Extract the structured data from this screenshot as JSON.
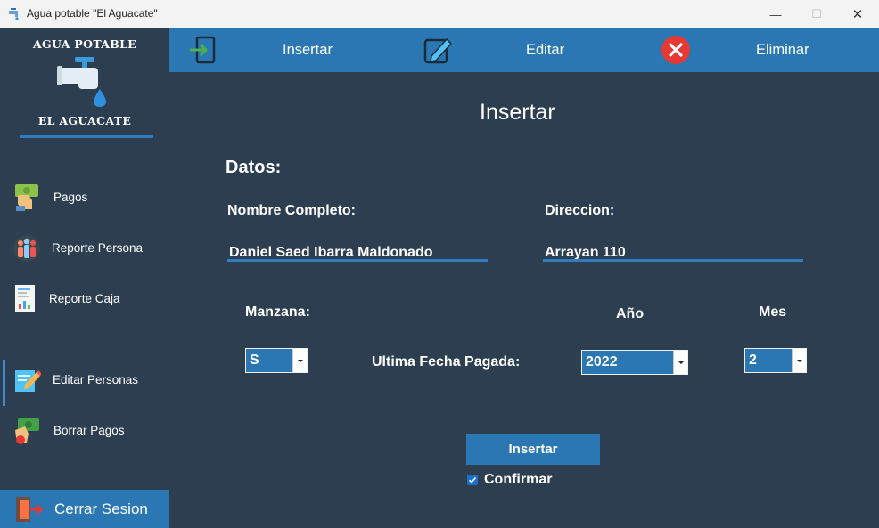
{
  "window": {
    "title": "Agua potable \"El Aguacate\"",
    "controls": {
      "minimize": "—",
      "maximize": "☐",
      "close": "✕"
    }
  },
  "sidebar": {
    "brand_top": "AGUA POTABLE",
    "brand_bottom": "EL AGUACATE",
    "items": [
      {
        "label": "Pagos",
        "icon": "cash-hand-icon"
      },
      {
        "label": "Reporte Persona",
        "icon": "people-group-icon"
      },
      {
        "label": "Reporte Caja",
        "icon": "report-document-icon"
      },
      {
        "label": "Editar Personas",
        "icon": "edit-note-icon",
        "active": true
      },
      {
        "label": "Borrar Pagos",
        "icon": "money-delete-icon"
      }
    ],
    "logout_label": "Cerrar Sesion"
  },
  "toolbar": {
    "insert_label": "Insertar",
    "edit_label": "Editar",
    "delete_label": "Eliminar"
  },
  "form": {
    "heading": "Insertar",
    "section_label": "Datos:",
    "name_label": "Nombre Completo:",
    "name_value": "Daniel Saed Ibarra Maldonado",
    "address_label": "Direccion:",
    "address_value": "Arrayan 110",
    "manzana_label": "Manzana:",
    "manzana_value": "S",
    "year_label": "Año",
    "month_label": "Mes",
    "last_paid_label": "Ultima Fecha Pagada:",
    "year_value": "2022",
    "month_value": "2",
    "submit_label": "Insertar",
    "confirm_label": "Confirmar",
    "confirm_checked": true
  },
  "colors": {
    "background": "#2c3e50",
    "accent": "#2a77b3",
    "underline": "#2f7dc0",
    "delete_red": "#e53935"
  }
}
